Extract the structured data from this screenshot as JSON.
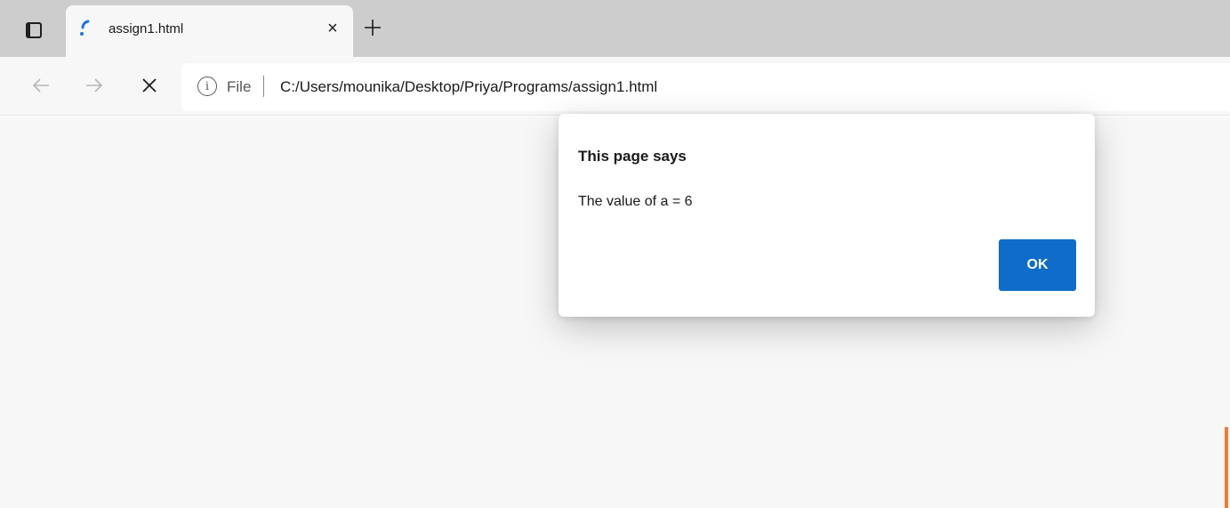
{
  "tab": {
    "title": "assign1.html",
    "close_glyph": "×",
    "favicon": "loading-spinner-icon",
    "new_tab_icon": "plus-icon",
    "tab_actions_icon": "tab-actions-icon"
  },
  "toolbar": {
    "back_icon": "back-arrow-icon",
    "forward_icon": "forward-arrow-icon",
    "stop_icon": "stop-icon"
  },
  "address": {
    "info_glyph": "i",
    "scheme": "File",
    "url": "C:/Users/mounika/Desktop/Priya/Programs/assign1.html"
  },
  "dialog": {
    "title": "This page says",
    "message": "The value of a = 6",
    "ok_label": "OK"
  },
  "colors": {
    "accent": "#0f6cc9",
    "tabstrip": "#cdcdcd",
    "page_bg": "#f7f7f7",
    "marker": "#ed7d31"
  }
}
